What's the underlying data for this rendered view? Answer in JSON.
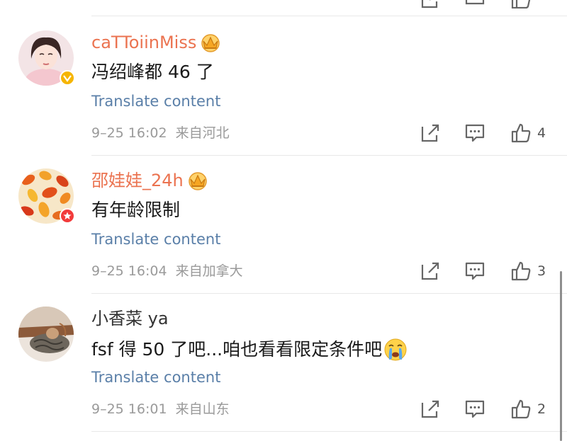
{
  "comments": [
    {
      "username": "caTToiinMiss",
      "text": "冯绍峰都 46 了",
      "translate": "Translate content",
      "time": "9–25 16:02",
      "location": "来自河北",
      "likes": "4"
    },
    {
      "username": "邵娃娃_24h",
      "text": "有年龄限制",
      "translate": "Translate content",
      "time": "9–25 16:04",
      "location": "来自加拿大",
      "likes": "3"
    },
    {
      "username": "小香菜 ya",
      "text": "fsf 得 50 了吧...咱也看看限定条件吧",
      "translate": "Translate content",
      "time": "9–25 16:01",
      "location": "来自山东",
      "likes": "2"
    }
  ],
  "colors": {
    "vip_name": "#eb7350",
    "normal_name": "#333333",
    "translate_link": "#5a7fa8",
    "meta": "#9a9a9a",
    "icon": "#666666"
  },
  "icons": [
    "crown-icon",
    "verified-badge-icon",
    "share-icon",
    "comment-icon",
    "like-icon",
    "crying-emoji-icon"
  ]
}
